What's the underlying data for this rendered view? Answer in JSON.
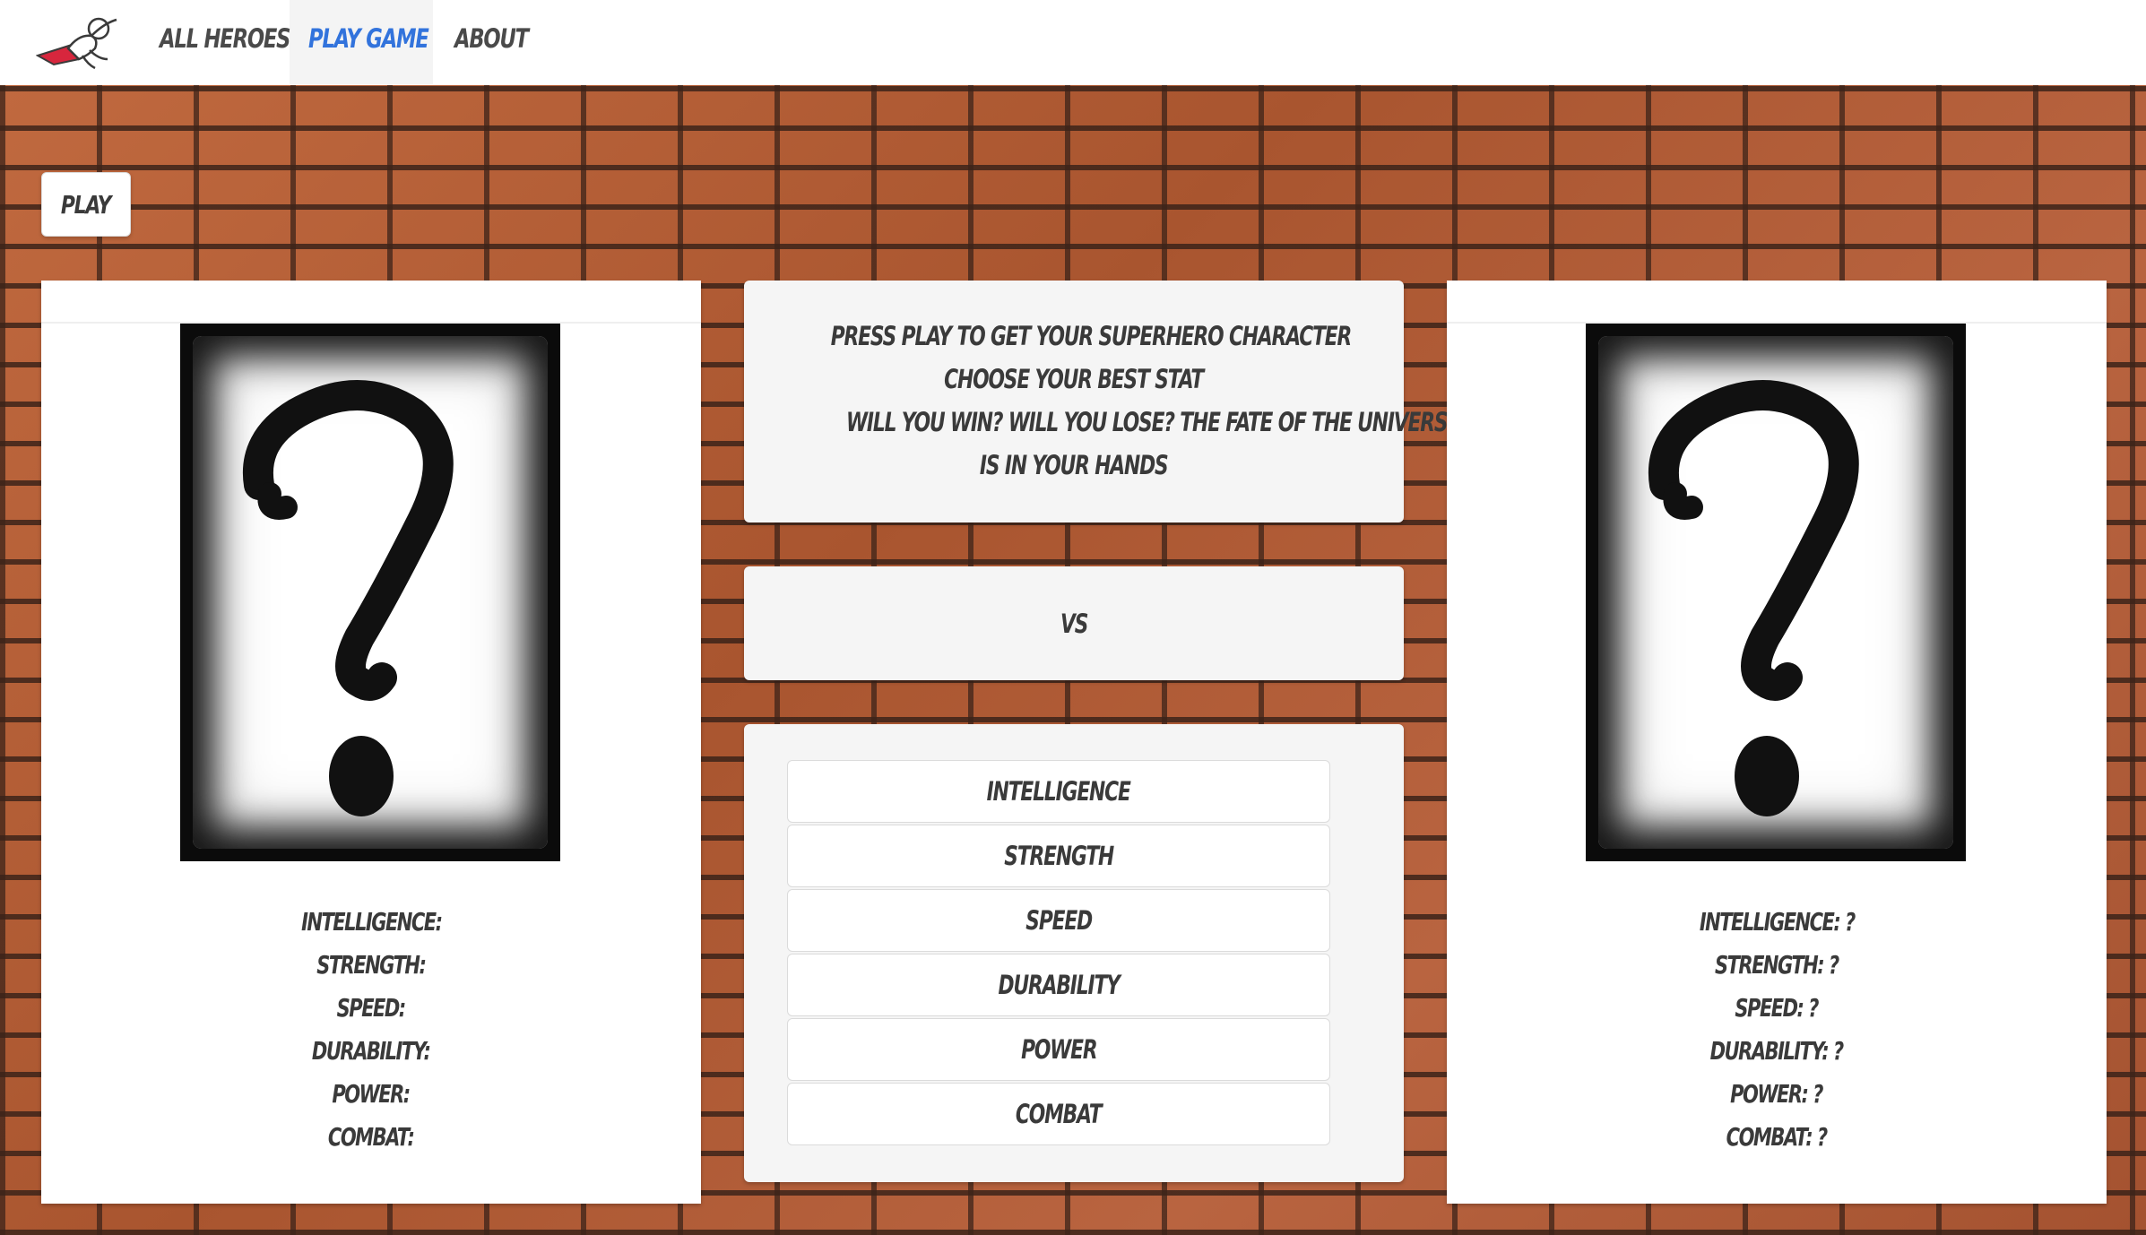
{
  "nav": {
    "logo": "superhero-logo-icon",
    "items": [
      {
        "label": "All Heroes",
        "active": false
      },
      {
        "label": "Play Game",
        "active": true
      },
      {
        "label": "About",
        "active": false
      }
    ],
    "active_color": "#3273dc",
    "text_color": "#4a4a4a"
  },
  "play_button": {
    "label": "Play"
  },
  "instructions": {
    "lines": [
      "Press play to get your superhero character",
      "Choose your best stat",
      "Will you win? Will you lose? The fate of the universe",
      "is in your hands"
    ]
  },
  "versus": {
    "label": "VS"
  },
  "stat_buttons": [
    "Intelligence",
    "Strength",
    "Speed",
    "Durability",
    "Power",
    "Combat"
  ],
  "player_card": {
    "image": "question-mark-card",
    "stats": [
      {
        "label": "Intelligence:",
        "value": ""
      },
      {
        "label": "Strength:",
        "value": ""
      },
      {
        "label": "Speed:",
        "value": ""
      },
      {
        "label": "Durability:",
        "value": ""
      },
      {
        "label": "Power:",
        "value": ""
      },
      {
        "label": "Combat:",
        "value": ""
      }
    ]
  },
  "opponent_card": {
    "image": "question-mark-card",
    "stats": [
      {
        "label": "Intelligence:",
        "value": "?"
      },
      {
        "label": "Strength:",
        "value": "?"
      },
      {
        "label": "Speed:",
        "value": "?"
      },
      {
        "label": "Durability:",
        "value": "?"
      },
      {
        "label": "Power:",
        "value": "?"
      },
      {
        "label": "Combat:",
        "value": "?"
      }
    ]
  },
  "colors": {
    "brick": "#b5603a",
    "mortar": "#3c2319",
    "logo_cape": "#d7263d"
  }
}
